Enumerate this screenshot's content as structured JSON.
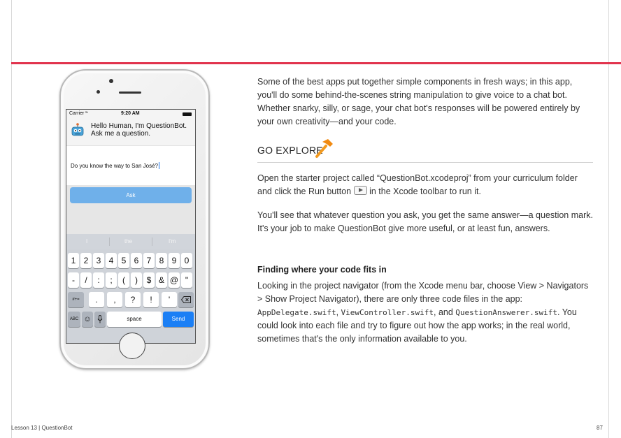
{
  "page": {
    "accent_color": "#e1334d",
    "footer": {
      "lesson": "Lesson 13  |  QuestionBot",
      "page_number": "87"
    }
  },
  "phone": {
    "status": {
      "carrier": "Carrier",
      "time": "9:20 AM"
    },
    "bot_message": "Hello Human, I'm QuestionBot. Ask me a question.",
    "question_value": "Do you know the way to San José?",
    "ask_label": "Ask",
    "predictions": [
      "I",
      "the",
      "I'm"
    ],
    "keyboard": {
      "row1": [
        "1",
        "2",
        "3",
        "4",
        "5",
        "6",
        "7",
        "8",
        "9",
        "0"
      ],
      "row2": [
        "-",
        "/",
        ":",
        ";",
        "(",
        ")",
        "$",
        "&",
        "@",
        "\""
      ],
      "row3": [
        ".",
        ",",
        "?",
        "!",
        "'"
      ],
      "mode_key": "#+=",
      "abc_key": "ABC",
      "space_key": "space",
      "send_key": "Send"
    },
    "icons": [
      "wifi-icon",
      "battery-icon",
      "robot-icon",
      "backspace-icon",
      "emoji-icon",
      "microphone-icon"
    ]
  },
  "content": {
    "intro": "Some of the best apps put together simple components in fresh ways; in this app, you'll do some behind-the-scenes string manipulation to give voice to a chat bot. Whether snarky, silly, or sage, your chat bot's responses will be powered entirely by your own creativity—and your code.",
    "go_explore": "GO EXPLORE",
    "explore_para1_a": "Open the starter project called “QuestionBot.xcodeproj” from your curriculum folder and click the Run button",
    "explore_para1_b": "in the Xcode toolbar to run it.",
    "explore_para2": "You'll see that whatever question you ask, you get the same answer—a question mark. It's your job to make QuestionBot give more useful, or at least fun, answers.",
    "subheading": "Finding where your code fits in",
    "body_a": "Looking in the project navigator (from the Xcode menu bar, choose View > Navigators > Show Project Navigator), there are only three code files in the app:",
    "file1": "AppDelegate.swift",
    "sep1": ", ",
    "file2": "ViewController.swift",
    "sep2": ", and ",
    "file3": "QuestionAnswerer.swift",
    "body_b": ". You could look into each file and try to figure out how the app works; in the real world, sometimes that's the only information available to you."
  }
}
